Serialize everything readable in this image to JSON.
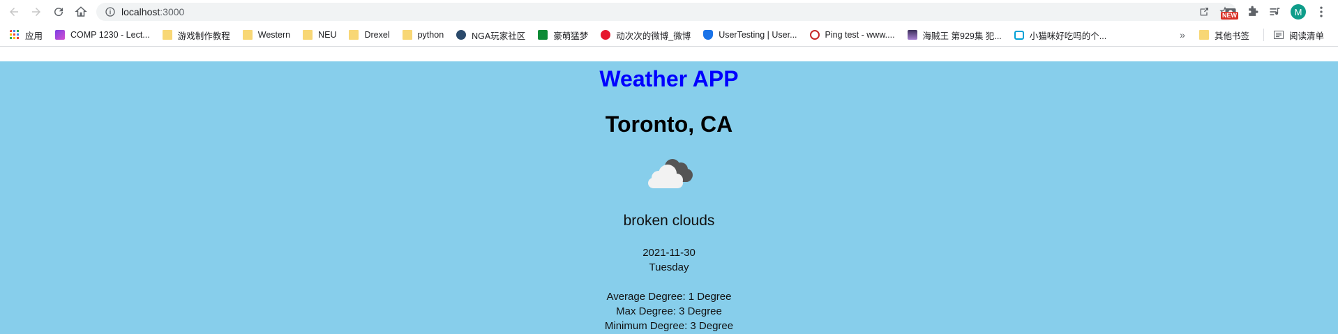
{
  "browser": {
    "url_host": "localhost",
    "url_port": ":3000",
    "new_badge": "NEW",
    "avatar_letter": "M"
  },
  "bookmarks": {
    "items": [
      {
        "label": "应用",
        "icon": "apps-grid-icon"
      },
      {
        "label": "COMP 1230 - Lect...",
        "icon": "course-icon"
      },
      {
        "label": "游戏制作教程",
        "icon": "folder-icon"
      },
      {
        "label": "Western",
        "icon": "folder-icon"
      },
      {
        "label": "NEU",
        "icon": "folder-icon"
      },
      {
        "label": "Drexel",
        "icon": "folder-icon"
      },
      {
        "label": "python",
        "icon": "folder-icon"
      },
      {
        "label": "NGA玩家社区",
        "icon": "nga-icon"
      },
      {
        "label": "豪萌猛梦",
        "icon": "douban-icon"
      },
      {
        "label": "动次次的微博_微博",
        "icon": "weibo-icon"
      },
      {
        "label": "UserTesting | User...",
        "icon": "usertesting-icon"
      },
      {
        "label": "Ping test - www....",
        "icon": "ping-icon"
      },
      {
        "label": "海贼王 第929集 犯...",
        "icon": "anime-icon"
      },
      {
        "label": "小猫咪好吃吗的个...",
        "icon": "bilibili-icon"
      }
    ],
    "more": "»",
    "other_bookmarks": "其他书签",
    "reading_list": "阅读清单"
  },
  "weather": {
    "app_title": "Weather APP",
    "city": "Toronto, CA",
    "icon": "broken-clouds-icon",
    "description": "broken clouds",
    "date": "2021-11-30",
    "day": "Tuesday",
    "average": "Average Degree: 1 Degree",
    "max": "Max Degree: 3 Degree",
    "min": "Minimum Degree: 3 Degree"
  },
  "colors": {
    "page_background": "#87ceeb",
    "title_color": "#0000ff"
  }
}
